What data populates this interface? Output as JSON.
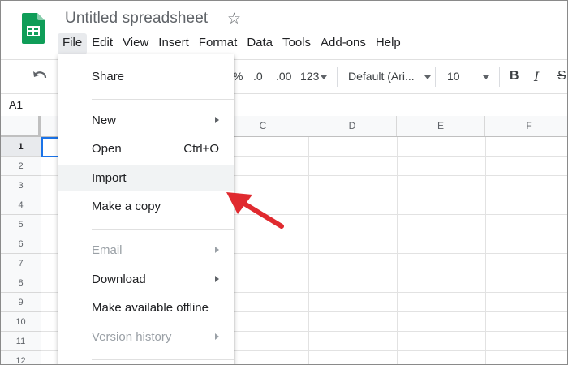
{
  "app": {
    "doc_title": "Untitled spreadsheet"
  },
  "colors": {
    "sheets_green": "#0f9d58",
    "accent_blue": "#1a73e8",
    "arrow_red": "#e02a2f"
  },
  "menubar": [
    {
      "label": "File",
      "active": true
    },
    {
      "label": "Edit"
    },
    {
      "label": "View"
    },
    {
      "label": "Insert"
    },
    {
      "label": "Format"
    },
    {
      "label": "Data"
    },
    {
      "label": "Tools"
    },
    {
      "label": "Add-ons"
    },
    {
      "label": "Help"
    }
  ],
  "toolbar": {
    "percent": "%",
    "decrease_decimal": ".0",
    "increase_decimal": ".00",
    "number_format": "123",
    "font_family": "Default (Ari...",
    "font_size": "10",
    "bold": "B",
    "italic": "I",
    "strikethrough": "S"
  },
  "formula_bar": {
    "cell_ref": "A1"
  },
  "grid": {
    "columns": [
      "C",
      "D",
      "E",
      "F"
    ],
    "rows": [
      "1",
      "2",
      "3",
      "4",
      "5",
      "6",
      "7",
      "8",
      "9",
      "10",
      "11",
      "12"
    ],
    "selected_row": "1"
  },
  "file_menu": {
    "items": [
      {
        "label": "Share"
      },
      {
        "label": "New",
        "submenu": true
      },
      {
        "label": "Open",
        "shortcut": "Ctrl+O"
      },
      {
        "label": "Import",
        "hover": true
      },
      {
        "label": "Make a copy"
      },
      {
        "label": "Email",
        "submenu": true,
        "disabled": true
      },
      {
        "label": "Download",
        "submenu": true
      },
      {
        "label": "Make available offline"
      },
      {
        "label": "Version history",
        "submenu": true,
        "disabled": true
      }
    ]
  },
  "annotation": {
    "arrow_target": "Import",
    "icon": "red-arrow-icon"
  }
}
